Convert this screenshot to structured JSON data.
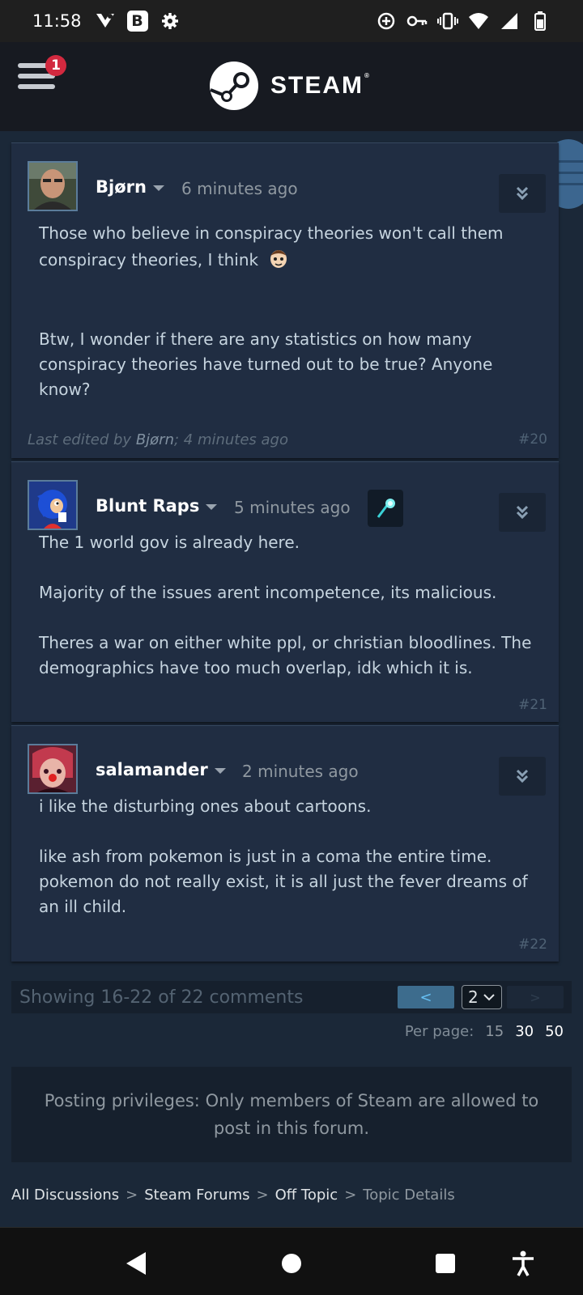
{
  "status_bar": {
    "time": "11:58",
    "left_icons": [
      "signal-fox-icon",
      "b-app-icon",
      "gear-icon"
    ],
    "b_label": "B",
    "right_icons": [
      "data-saver-icon",
      "vpn-key-icon",
      "vibrate-icon",
      "wifi-icon",
      "cell-signal-icon",
      "battery-icon"
    ]
  },
  "header": {
    "menu_badge": "1",
    "logo_text": "STEAM",
    "logo_mark": "®"
  },
  "posts": [
    {
      "author": "Bjørn",
      "time": "6 minutes ago",
      "paragraphs": [
        "Those who believe in conspiracy theories won't call them conspiracy theories, I think",
        "Btw, I wonder if there are any statistics on how many conspiracy theories have turned out to be true? Anyone know?"
      ],
      "edited_prefix": "Last edited by",
      "edited_by": "Bjørn",
      "edited_suffix": "; 4 minutes ago",
      "number": "#20"
    },
    {
      "author": "Blunt Raps",
      "time": "5 minutes ago",
      "paragraphs": [
        "The 1 world gov is already here.",
        "Majority of the issues arent incompetence, its malicious.",
        "Theres a war on either white ppl, or christian bloodlines. The demographics have too much overlap, idk which it is."
      ],
      "number": "#21"
    },
    {
      "author": "salamander",
      "time": "2 minutes ago",
      "paragraphs": [
        "i like the disturbing ones about cartoons.",
        "like ash from pokemon is just in a coma the entire time. pokemon do not really exist, it is all just the fever dreams of an ill child."
      ],
      "number": "#22"
    }
  ],
  "pagination": {
    "summary": "Showing 16-22 of 22 comments",
    "prev_label": "<",
    "current_page": "2",
    "next_label": ">",
    "per_page_label": "Per page:",
    "per_page_options": [
      "15",
      "30",
      "50"
    ],
    "per_page_selected": "15"
  },
  "notice": {
    "text": "Posting privileges: Only members of Steam are allowed to post in this forum."
  },
  "breadcrumbs": {
    "items": [
      "All Discussions",
      "Steam Forums",
      "Off Topic",
      "Topic Details"
    ],
    "separator": ">"
  },
  "colors": {
    "background": "#1b2838",
    "post_background": "#202d42",
    "header_background": "#171a21",
    "accent_blue": "#66c0f4",
    "badge_red": "#d2293f"
  }
}
